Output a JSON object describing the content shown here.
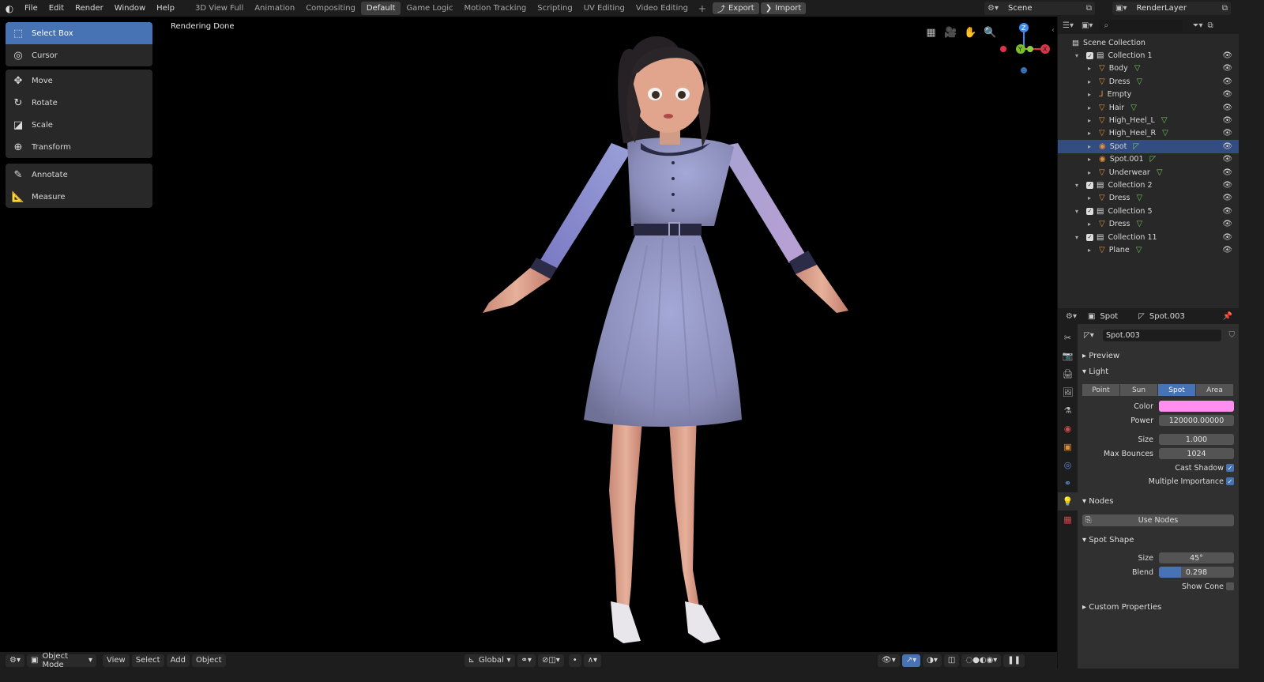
{
  "topbar": {
    "menus": [
      "File",
      "Edit",
      "Render",
      "Window",
      "Help"
    ],
    "workspaces": [
      "3D View Full",
      "Animation",
      "Compositing",
      "Default",
      "Game Logic",
      "Motion Tracking",
      "Scripting",
      "UV Editing",
      "Video Editing"
    ],
    "active_workspace": "Default",
    "add_tab": "+",
    "export_label": "Export",
    "import_label": "Import",
    "scene_name": "Scene",
    "render_layer": "RenderLayer"
  },
  "tools": {
    "group1": [
      "Select Box",
      "Cursor"
    ],
    "group2": [
      "Move",
      "Rotate",
      "Scale",
      "Transform"
    ],
    "group3": [
      "Annotate",
      "Measure"
    ],
    "active": "Select Box"
  },
  "viewport": {
    "status": "Rendering Done",
    "gizmo": {
      "z": "Z",
      "y": "Y",
      "x": "X"
    }
  },
  "bottombar": {
    "mode": "Object Mode",
    "menus": [
      "View",
      "Select",
      "Add",
      "Object"
    ],
    "orientation": "Global"
  },
  "outliner": {
    "root": "Scene Collection",
    "rows": [
      {
        "label": "Collection 1",
        "type": "collection",
        "indent": 1
      },
      {
        "label": "Body",
        "type": "object",
        "indent": 2
      },
      {
        "label": "Dress",
        "type": "object",
        "indent": 2
      },
      {
        "label": "Empty",
        "type": "empty",
        "indent": 2
      },
      {
        "label": "Hair",
        "type": "object",
        "indent": 2
      },
      {
        "label": "High_Heel_L",
        "type": "object",
        "indent": 2
      },
      {
        "label": "High_Heel_R",
        "type": "object",
        "indent": 2
      },
      {
        "label": "Spot",
        "type": "light",
        "indent": 2,
        "selected": true
      },
      {
        "label": "Spot.001",
        "type": "light",
        "indent": 2
      },
      {
        "label": "Underwear",
        "type": "object",
        "indent": 2
      },
      {
        "label": "Collection 2",
        "type": "collection",
        "indent": 1
      },
      {
        "label": "Dress",
        "type": "object",
        "indent": 2
      },
      {
        "label": "Collection 5",
        "type": "collection",
        "indent": 1
      },
      {
        "label": "Dress",
        "type": "object",
        "indent": 2
      },
      {
        "label": "Collection 11",
        "type": "collection",
        "indent": 1
      },
      {
        "label": "Plane",
        "type": "object",
        "indent": 2
      }
    ]
  },
  "properties": {
    "object_name": "Spot",
    "data_name": "Spot.003",
    "datablock": "Spot.003",
    "sections": {
      "preview": "Preview",
      "light": "Light",
      "nodes": "Nodes",
      "spot_shape": "Spot Shape",
      "custom": "Custom Properties"
    },
    "light_types": [
      "Point",
      "Sun",
      "Spot",
      "Area"
    ],
    "active_light_type": "Spot",
    "color_label": "Color",
    "color_value": "#ff8ef0",
    "power_label": "Power",
    "power": "120000.00000",
    "size_label": "Size",
    "size": "1.000",
    "bounces_label": "Max Bounces",
    "bounces": "1024",
    "cast_shadow_label": "Cast Shadow",
    "multi_imp_label": "Multiple Importance",
    "use_nodes": "Use Nodes",
    "spot_size_label": "Size",
    "spot_size": "45°",
    "blend_label": "Blend",
    "blend": "0.298",
    "blend_fraction": 0.298,
    "show_cone_label": "Show Cone"
  },
  "colors": {
    "accent": "#4772b3",
    "selection": "#334d80",
    "object_orange": "#e0903a",
    "mesh_green": "#6ec25a"
  }
}
